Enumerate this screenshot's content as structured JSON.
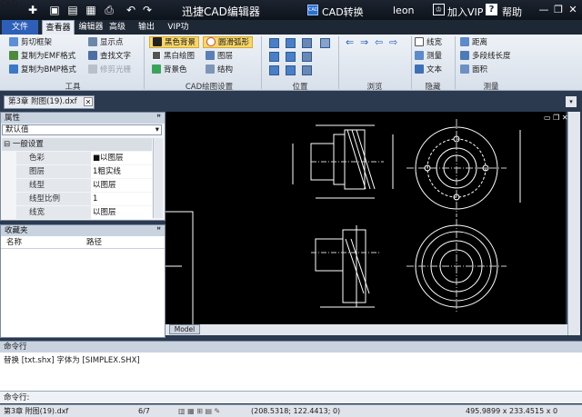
{
  "app": {
    "title": "迅捷CAD编辑器",
    "logo_text": "CAD",
    "cad_convert": "CAD转换",
    "user": "leon",
    "vip_label": "加入VIP",
    "help_label": "帮助"
  },
  "menu_tabs": [
    "文件",
    "查看器",
    "编辑器",
    "高级",
    "输出",
    "VIP功能"
  ],
  "ribbon": {
    "tools": {
      "items": [
        "剪切框架",
        "复制为EMF格式",
        "复制为BMP格式",
        "显示点",
        "查找文字",
        "修剪光栅"
      ],
      "label": "工具"
    },
    "cad_settings": {
      "items": [
        "黑色背景",
        "黑白绘图",
        "背景色",
        "圆滑弧形",
        "图层",
        "结构"
      ],
      "label": "CAD绘图设置"
    },
    "position": {
      "label": "位置"
    },
    "browse": {
      "label": "浏览"
    },
    "hide": {
      "items": [
        "线宽",
        "测量",
        "文本"
      ],
      "label": "隐藏"
    },
    "measure": {
      "items": [
        "距离",
        "多段线长度",
        "面积"
      ],
      "label": "测量"
    }
  },
  "document_tab": "第3章  附图(19).dxf",
  "properties": {
    "title": "属性",
    "combo_value": "默认值",
    "section": "一般设置",
    "rows": [
      {
        "name": "色彩",
        "value": "■以图层"
      },
      {
        "name": "图层",
        "value": "1粗实线"
      },
      {
        "name": "线型",
        "value": "以图层"
      },
      {
        "name": "线型比例",
        "value": "1"
      },
      {
        "name": "线宽",
        "value": "以图层"
      }
    ]
  },
  "favorites": {
    "title": "收藏夹",
    "columns": [
      "名称",
      "路径"
    ]
  },
  "canvas": {
    "model_tab": "Model"
  },
  "command": {
    "title": "命令行",
    "output": "替换 [txt.shx] 字体为 [SIMPLEX.SHX]",
    "prompt": "命令行:"
  },
  "status": {
    "file": "第3章  附图(19).dxf",
    "page": "6/7",
    "cursor": "(208.5318; 122.4413; 0)",
    "size": "495.9899 x 233.4515 x 0"
  },
  "colors": {
    "accent": "#2d5fb8",
    "titlebar": "#0d131b",
    "canvas": "#000000"
  }
}
